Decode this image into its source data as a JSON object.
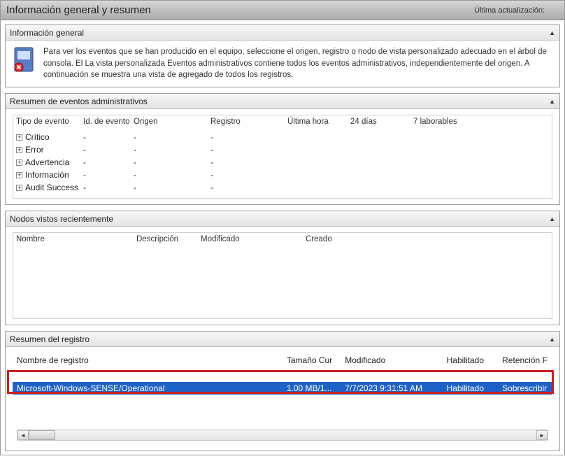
{
  "titlebar": {
    "title": "Información general y resumen",
    "last_update_label": "Última actualización:"
  },
  "panels": {
    "info": {
      "title": "Información general",
      "text": "Para ver los eventos que se han producido en el equipo, seleccione el origen, registro o nodo de vista personalizado adecuado en el árbol de consola. El La vista personalizada Eventos administrativos contiene todos los eventos administrativos, independientemente del origen. A continuación se muestra una vista de agregado de todos los registros."
    },
    "admin_events": {
      "title": "Resumen de eventos administrativos",
      "columns": {
        "event_type": "Tipo de evento",
        "event_id": "Id. de evento",
        "source": "Origen",
        "log": "Registro",
        "last_hour": "Última hora",
        "days24": "24 días",
        "work7": "7 laborables"
      },
      "rows": [
        {
          "label": "Crítico",
          "id": "-",
          "src": "-",
          "log": "-"
        },
        {
          "label": "Error",
          "id": "-",
          "src": "-",
          "log": "-"
        },
        {
          "label": "Advertencia",
          "id": "-",
          "src": "-",
          "log": "-"
        },
        {
          "label": "Información",
          "id": "-",
          "src": "-",
          "log": "-"
        },
        {
          "label": "Audit Success",
          "id": "-",
          "src": "-",
          "log": "-"
        }
      ]
    },
    "recent_nodes": {
      "title": "Nodos vistos recientemente",
      "columns": {
        "name": "Nombre",
        "description": "Descripción",
        "modified": "Modificado",
        "created": "Creado"
      }
    },
    "log_summary": {
      "title": "Resumen del registro",
      "columns": {
        "log_name": "Nombre de registro",
        "cur_size": "Tamaño Cur",
        "modified": "Modificado",
        "enabled": "Habilitado",
        "retention": "Retención F"
      },
      "selected_row": {
        "name": "Microsoft-Windows-SENSE/Operational",
        "size": "1.00 MB/1...",
        "modified": "7/7/2023 9:31:51 AM",
        "enabled": "Habilitado",
        "retention": "Sobrescribir"
      }
    }
  }
}
